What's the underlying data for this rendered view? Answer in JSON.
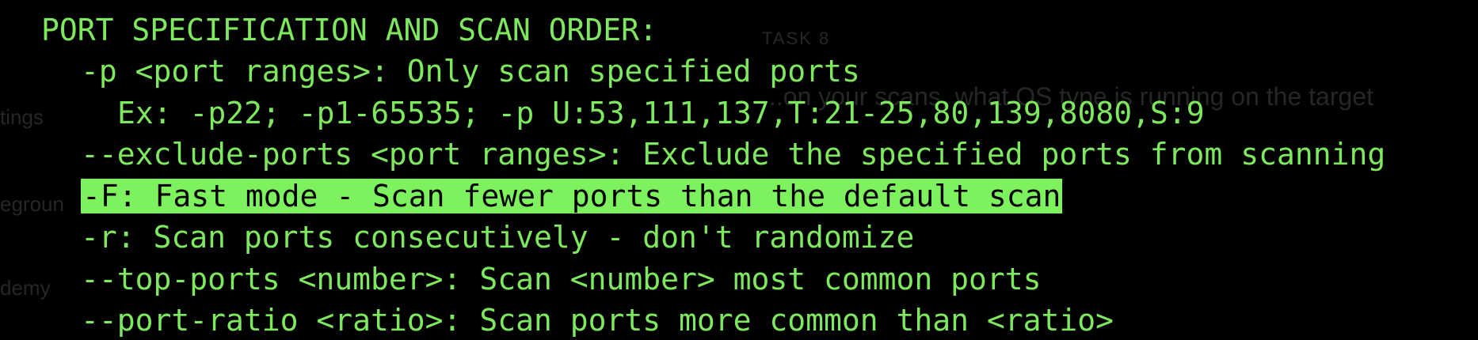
{
  "background_ui": {
    "task_label": "TASK 8",
    "question_text": "...on your scans, what OS type is running on the target",
    "sidebar_fragments": [
      "tings",
      "egroun",
      "demy"
    ]
  },
  "terminal": {
    "heading": "PORT SPECIFICATION AND SCAN ORDER:",
    "lines": [
      "-p <port ranges>: Only scan specified ports",
      "  Ex: -p22; -p1-65535; -p U:53,111,137,T:21-25,80,139,8080,S:9",
      "--exclude-ports <port ranges>: Exclude the specified ports from scanning",
      "-F: Fast mode - Scan fewer ports than the default scan",
      "-r: Scan ports consecutively - don't randomize",
      "--top-ports <number>: Scan <number> most common ports",
      "--port-ratio <ratio>: Scan ports more common than <ratio>"
    ],
    "highlighted_line_index": 3
  },
  "colors": {
    "terminal_bg": "#000000",
    "terminal_text": "#7ee85e",
    "highlight_bg": "#7ef25e",
    "highlight_text": "#000000"
  }
}
